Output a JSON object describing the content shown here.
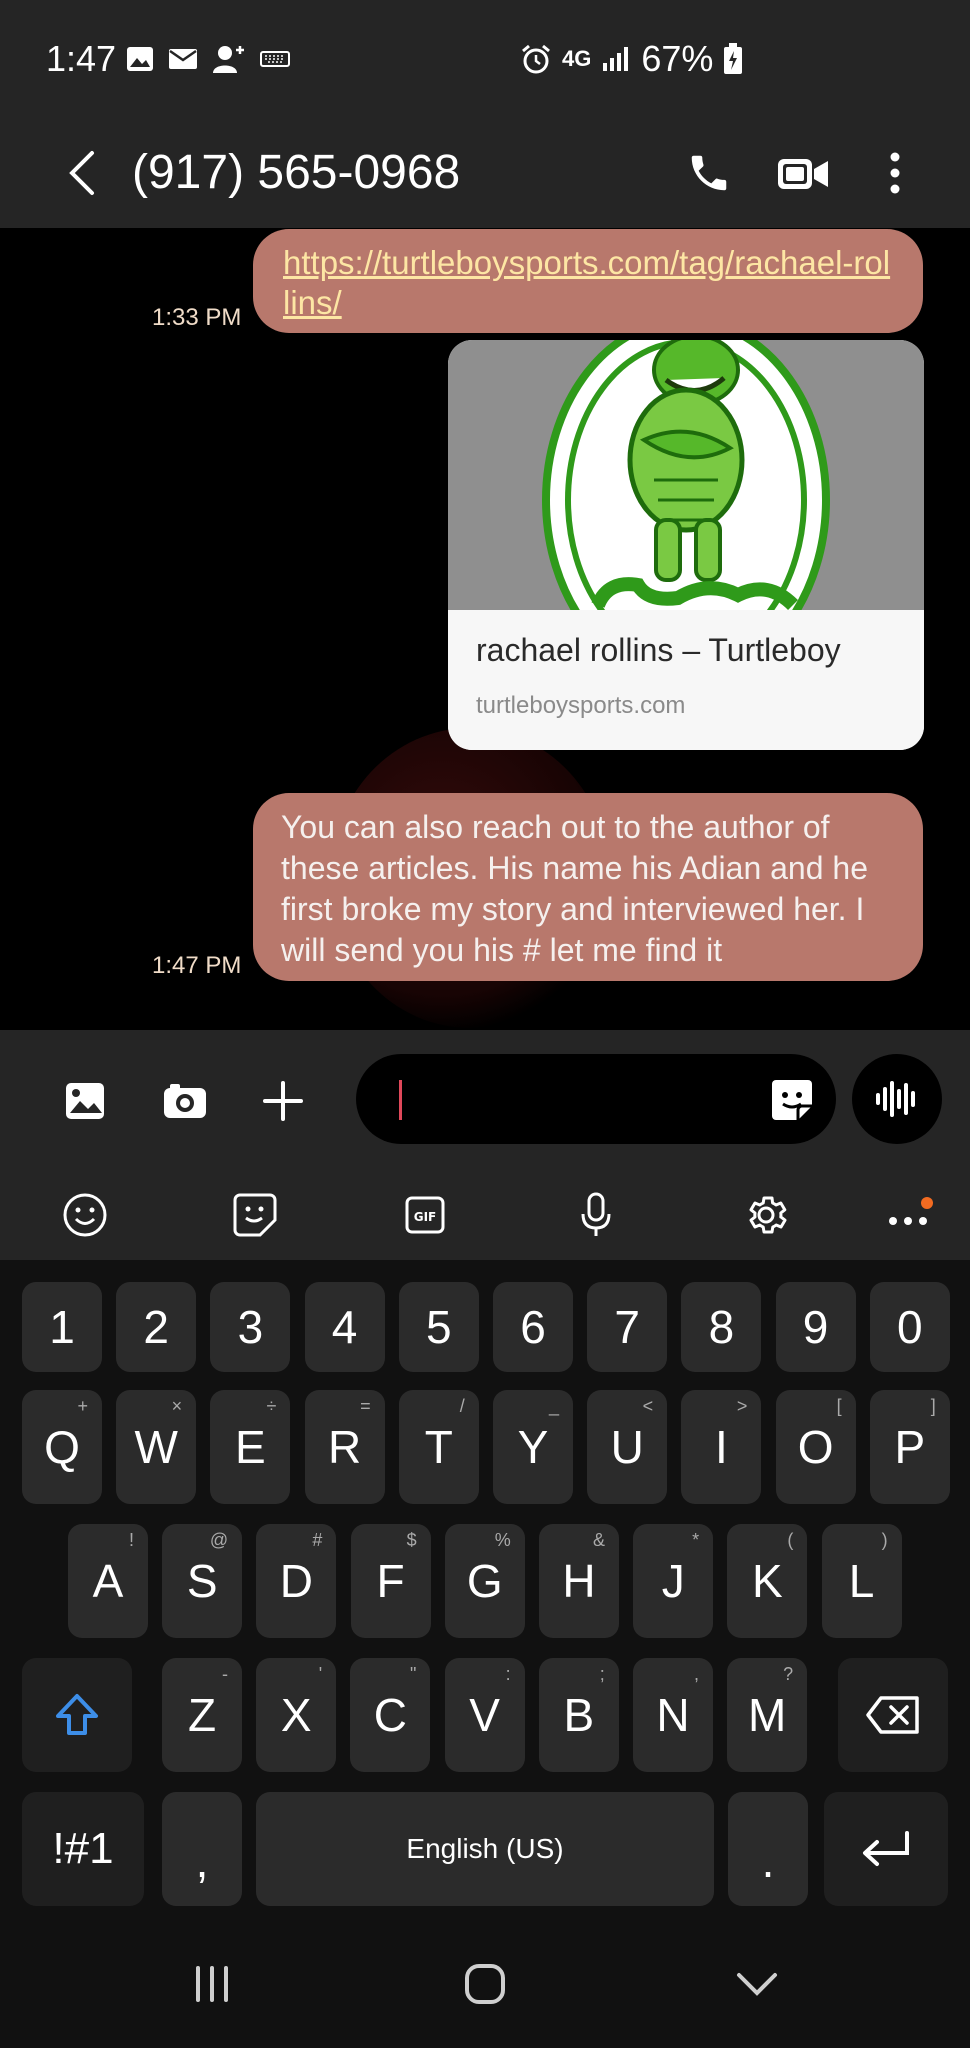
{
  "status_bar": {
    "time": "1:47",
    "network": "4G",
    "battery": "67%"
  },
  "header": {
    "contact": "(917) 565-0968"
  },
  "messages": [
    {
      "type": "link",
      "text": "https://turtleboysports.com/tag/rachael-rollins/",
      "time": "1:33 PM",
      "preview": {
        "title": "rachael rollins – Turtleboy",
        "domain": "turtleboysports.com"
      }
    },
    {
      "type": "text",
      "text": "You can also reach out to the author of these articles. His name his Adian and he first broke my story and interviewed her. I will send you his # let me find it",
      "time": "1:47 PM"
    }
  ],
  "colors": {
    "bubble": "#b8786c",
    "link": "#fde6a4",
    "panel": "#252525",
    "keyboard_bg": "#111111",
    "key": "#2b2b2b",
    "shift_accent": "#3d8ee8",
    "notification_dot": "#f26b21"
  },
  "keyboard": {
    "numbers": [
      "1",
      "2",
      "3",
      "4",
      "5",
      "6",
      "7",
      "8",
      "9",
      "0"
    ],
    "row1": [
      {
        "key": "Q",
        "hint": "+"
      },
      {
        "key": "W",
        "hint": "×"
      },
      {
        "key": "E",
        "hint": "÷"
      },
      {
        "key": "R",
        "hint": "="
      },
      {
        "key": "T",
        "hint": "/"
      },
      {
        "key": "Y",
        "hint": "_"
      },
      {
        "key": "U",
        "hint": "<"
      },
      {
        "key": "I",
        "hint": ">"
      },
      {
        "key": "O",
        "hint": "["
      },
      {
        "key": "P",
        "hint": "]"
      }
    ],
    "row2": [
      {
        "key": "A",
        "hint": "!"
      },
      {
        "key": "S",
        "hint": "@"
      },
      {
        "key": "D",
        "hint": "#"
      },
      {
        "key": "F",
        "hint": "$"
      },
      {
        "key": "G",
        "hint": "%"
      },
      {
        "key": "H",
        "hint": "&"
      },
      {
        "key": "J",
        "hint": "*"
      },
      {
        "key": "K",
        "hint": "("
      },
      {
        "key": "L",
        "hint": ")"
      }
    ],
    "row3": [
      {
        "key": "Z",
        "hint": "-"
      },
      {
        "key": "X",
        "hint": "'"
      },
      {
        "key": "C",
        "hint": "\""
      },
      {
        "key": "V",
        "hint": ":"
      },
      {
        "key": "B",
        "hint": ";"
      },
      {
        "key": "N",
        "hint": ","
      },
      {
        "key": "M",
        "hint": "?"
      }
    ],
    "symbols_label": "!#1",
    "comma": ",",
    "space_label": "English (US)",
    "period": "."
  }
}
